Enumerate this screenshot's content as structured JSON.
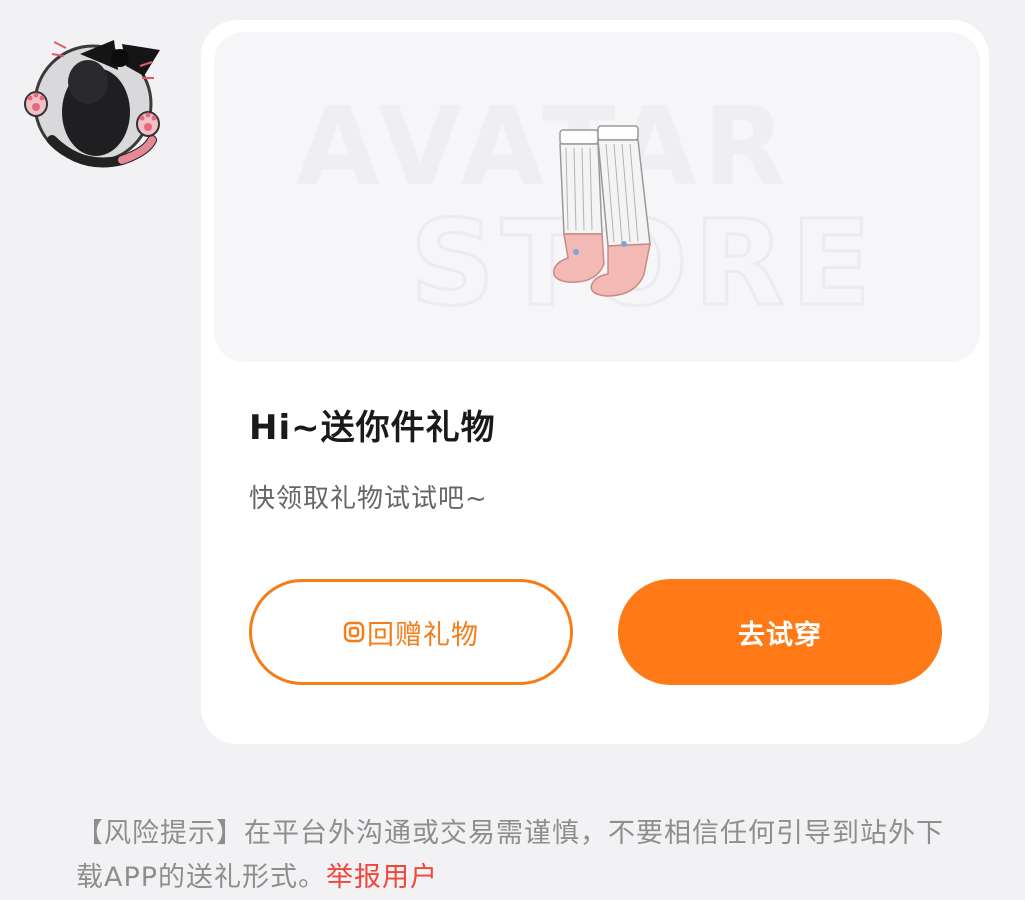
{
  "avatar": {
    "icon": "cat-girl-avatar"
  },
  "card": {
    "banner": {
      "watermark_line1": "AVATAR",
      "watermark_line2": "STORE",
      "item_icon": "socks-item"
    },
    "title": "Hi~送你件礼物",
    "subtitle": "快领取礼物试试吧~",
    "buttons": {
      "gift_back": "回赠礼物",
      "try_on": "去试穿"
    }
  },
  "risk_notice": {
    "text": "【风险提示】在平台外沟通或交易需谨慎，不要相信任何引导到站外下载APP的送礼形式。",
    "report_link": "举报用户"
  },
  "colors": {
    "accent": "#ff7a16",
    "report": "#f0463c",
    "background": "#f2f2f4"
  }
}
